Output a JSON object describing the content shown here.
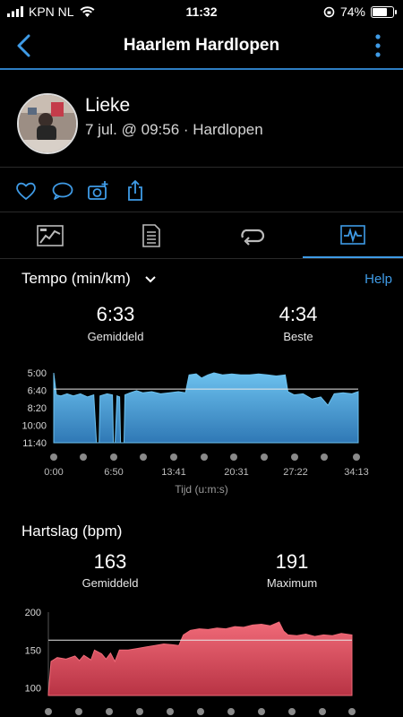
{
  "status": {
    "carrier": "KPN NL",
    "time": "11:32",
    "battery": "74%",
    "battery_level": 0.74
  },
  "nav": {
    "title": "Haarlem Hardlopen",
    "back_icon": "chevron-left-icon",
    "more_icon": "more-vertical-icon"
  },
  "profile": {
    "name": "Lieke",
    "subtitle": "7 jul. @ 09:56 · Hardlopen"
  },
  "actions": [
    "heart-icon",
    "comment-icon",
    "camera-add-icon",
    "share-icon"
  ],
  "tabs": [
    {
      "icon": "map-summary-icon",
      "active": false
    },
    {
      "icon": "details-list-icon",
      "active": false
    },
    {
      "icon": "laps-icon",
      "active": false
    },
    {
      "icon": "chart-icon",
      "active": true
    }
  ],
  "pace": {
    "title": "Tempo (min/km)",
    "help": "Help",
    "avg_value": "6:33",
    "avg_label": "Gemiddeld",
    "best_value": "4:34",
    "best_label": "Beste",
    "xlabel": "Tijd (u:m:s)"
  },
  "heart": {
    "title": "Hartslag (bpm)",
    "avg_value": "163",
    "avg_label": "Gemiddeld",
    "max_value": "191",
    "max_label": "Maximum"
  },
  "colors": {
    "accent": "#3f9be6",
    "pace_fill": "#4ba8e0",
    "heart_fill": "#e04a5a"
  },
  "chart_data": [
    {
      "type": "area",
      "title": "Tempo (min/km)",
      "xlabel": "Tijd (u:m:s)",
      "x_tick_labels": [
        "0:00",
        "6:50",
        "13:41",
        "20:31",
        "27:22",
        "34:13"
      ],
      "y_tick_labels": [
        "5:00",
        "6:40",
        "8:20",
        "10:00",
        "11:40"
      ],
      "y_reversed": true,
      "xlim_min": [
        0,
        34.2
      ],
      "ylim_min": [
        5.0,
        11.67
      ],
      "average_line": 6.55,
      "points": [
        [
          0,
          5.0
        ],
        [
          0.3,
          7.1
        ],
        [
          0.8,
          7.2
        ],
        [
          1.5,
          7.0
        ],
        [
          2.2,
          7.2
        ],
        [
          3.0,
          7.0
        ],
        [
          3.8,
          7.3
        ],
        [
          4.5,
          7.1
        ],
        [
          4.8,
          11.67
        ],
        [
          5.1,
          11.67
        ],
        [
          5.2,
          7.2
        ],
        [
          6.0,
          7.0
        ],
        [
          6.6,
          7.1
        ],
        [
          6.7,
          11.67
        ],
        [
          6.9,
          11.67
        ],
        [
          7.1,
          7.2
        ],
        [
          7.4,
          7.3
        ],
        [
          7.5,
          11.67
        ],
        [
          7.9,
          11.67
        ],
        [
          8.0,
          7.1
        ],
        [
          8.6,
          6.9
        ],
        [
          9.3,
          6.7
        ],
        [
          10.0,
          6.9
        ],
        [
          11.0,
          6.8
        ],
        [
          12.0,
          7.0
        ],
        [
          13.0,
          6.9
        ],
        [
          14.0,
          6.8
        ],
        [
          14.8,
          6.9
        ],
        [
          15.2,
          5.2
        ],
        [
          16.0,
          5.1
        ],
        [
          16.6,
          5.5
        ],
        [
          17.3,
          5.2
        ],
        [
          18.0,
          5.0
        ],
        [
          19.0,
          5.2
        ],
        [
          20.0,
          5.1
        ],
        [
          21.0,
          5.2
        ],
        [
          22.0,
          5.2
        ],
        [
          23.0,
          5.1
        ],
        [
          24.0,
          5.2
        ],
        [
          25.0,
          5.3
        ],
        [
          26.0,
          5.2
        ],
        [
          26.3,
          6.8
        ],
        [
          27.0,
          7.1
        ],
        [
          28.0,
          7.0
        ],
        [
          29.0,
          7.5
        ],
        [
          30.0,
          7.3
        ],
        [
          30.8,
          8.1
        ],
        [
          31.5,
          7.0
        ],
        [
          32.5,
          6.9
        ],
        [
          33.5,
          7.0
        ],
        [
          34.2,
          6.8
        ]
      ]
    },
    {
      "type": "area",
      "title": "Hartslag (bpm)",
      "y_tick_labels": [
        "200",
        "150",
        "100"
      ],
      "ylim": [
        90,
        200
      ],
      "xlim_min": [
        0,
        34.2
      ],
      "average_line": 163,
      "points": [
        [
          0,
          92
        ],
        [
          0.3,
          135
        ],
        [
          1.0,
          140
        ],
        [
          2.0,
          138
        ],
        [
          3.0,
          142
        ],
        [
          3.5,
          136
        ],
        [
          4.0,
          143
        ],
        [
          4.8,
          137
        ],
        [
          5.2,
          150
        ],
        [
          6.0,
          145
        ],
        [
          6.5,
          138
        ],
        [
          7.0,
          146
        ],
        [
          7.5,
          135
        ],
        [
          8.0,
          150
        ],
        [
          9.0,
          150
        ],
        [
          10.0,
          152
        ],
        [
          11.0,
          154
        ],
        [
          12.0,
          156
        ],
        [
          13.0,
          158
        ],
        [
          14.0,
          157
        ],
        [
          14.7,
          156
        ],
        [
          15.2,
          170
        ],
        [
          16.0,
          176
        ],
        [
          17.0,
          178
        ],
        [
          18.0,
          177
        ],
        [
          19.0,
          179
        ],
        [
          20.0,
          178
        ],
        [
          21.0,
          181
        ],
        [
          22.0,
          180
        ],
        [
          23.0,
          183
        ],
        [
          24.0,
          184
        ],
        [
          25.0,
          182
        ],
        [
          26.0,
          187
        ],
        [
          26.5,
          175
        ],
        [
          27.0,
          170
        ],
        [
          28.0,
          169
        ],
        [
          29.0,
          171
        ],
        [
          30.0,
          168
        ],
        [
          31.0,
          170
        ],
        [
          32.0,
          169
        ],
        [
          33.0,
          172
        ],
        [
          34.2,
          170
        ]
      ]
    }
  ]
}
